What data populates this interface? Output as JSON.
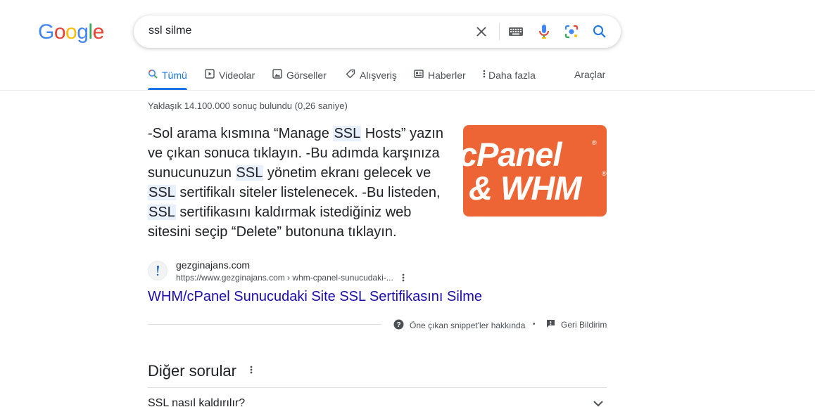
{
  "logo": {
    "letters": [
      "G",
      "o",
      "o",
      "g",
      "l",
      "e"
    ],
    "colors": [
      "#4285F4",
      "#EA4335",
      "#FBBC05",
      "#4285F4",
      "#34A853",
      "#EA4335"
    ]
  },
  "search": {
    "query": "ssl silme",
    "icons": [
      "clear-icon",
      "keyboard-icon",
      "mic-icon",
      "lens-icon",
      "search-icon"
    ]
  },
  "tabs": [
    {
      "label": "Tümü",
      "icon": "search-icon",
      "active": true
    },
    {
      "label": "Videolar",
      "icon": "play-icon"
    },
    {
      "label": "Görseller",
      "icon": "image-icon"
    },
    {
      "label": "Alışveriş",
      "icon": "tag-icon"
    },
    {
      "label": "Haberler",
      "icon": "news-icon"
    },
    {
      "label": "Daha fazla",
      "icon": "more-vert-icon"
    }
  ],
  "tools_label": "Araçlar",
  "stats": "Yaklaşık 14.100.000 sonuç bulundu (0,26 saniye)",
  "snippet": {
    "parts": [
      "-Sol arama kısmına “Manage ",
      "SSL",
      " Hosts” yazın ve çıkan sonuca tıklayın. -Bu adımda karşınıza sunucunuzun ",
      "SSL",
      " yönetim ekranı gelecek ve ",
      "SSL",
      " sertifikalı siteler listelenecek. -Bu listeden, ",
      "SSL",
      " sertifikasını kaldırmak istediğiniz web sitesini seçip “Delete” butonuna tıklayın."
    ],
    "image": {
      "line1": "cPanel",
      "line2": "& WHM",
      "reg": "®",
      "bg": "#ee6535"
    }
  },
  "result": {
    "site_name": "gezginajans.com",
    "url": "https://www.gezginajans.com › whm-cpanel-sunucudaki-...",
    "title": "WHM/cPanel Sunucudaki Site SSL Sertifikasını Silme",
    "title_color": "#1a0dab"
  },
  "feedback": {
    "about": "Öne çıkan snippet'ler hakkında",
    "separator": "•",
    "report": "Geri Bildirim"
  },
  "paa": {
    "title": "Diğer sorular",
    "questions": [
      "SSL nasıl kaldırılır?"
    ]
  }
}
